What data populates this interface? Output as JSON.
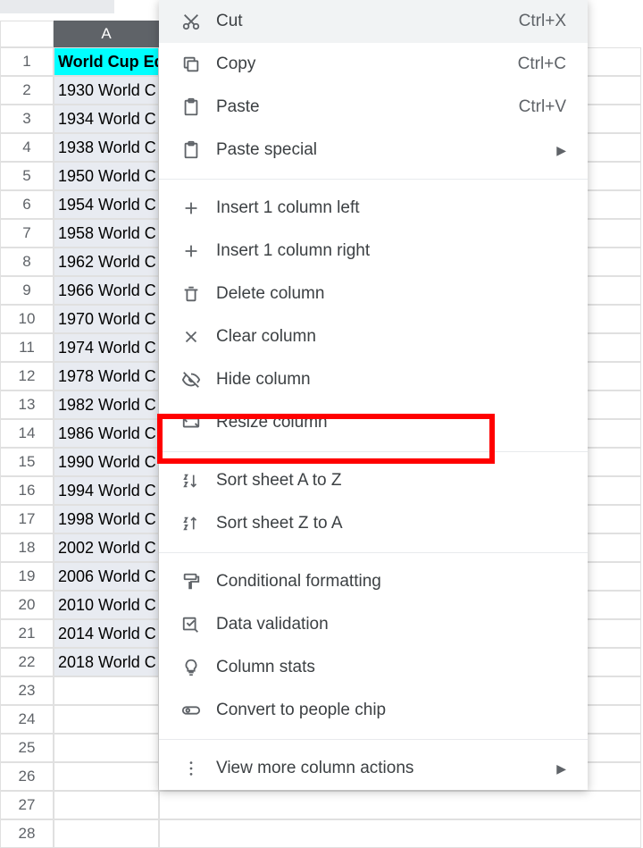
{
  "columnHeader": "A",
  "rows": [
    {
      "num": "1",
      "val": "World Cup Ed",
      "hdr": true
    },
    {
      "num": "2",
      "val": "1930 World C"
    },
    {
      "num": "3",
      "val": "1934 World C"
    },
    {
      "num": "4",
      "val": "1938 World C"
    },
    {
      "num": "5",
      "val": "1950 World C"
    },
    {
      "num": "6",
      "val": "1954 World C"
    },
    {
      "num": "7",
      "val": "1958 World C"
    },
    {
      "num": "8",
      "val": "1962 World C"
    },
    {
      "num": "9",
      "val": "1966 World C"
    },
    {
      "num": "10",
      "val": "1970 World C"
    },
    {
      "num": "11",
      "val": "1974 World C"
    },
    {
      "num": "12",
      "val": "1978 World C"
    },
    {
      "num": "13",
      "val": "1982 World C"
    },
    {
      "num": "14",
      "val": "1986 World C"
    },
    {
      "num": "15",
      "val": "1990 World C"
    },
    {
      "num": "16",
      "val": "1994 World C"
    },
    {
      "num": "17",
      "val": "1998 World C"
    },
    {
      "num": "18",
      "val": "2002 World C"
    },
    {
      "num": "19",
      "val": "2006 World C"
    },
    {
      "num": "20",
      "val": "2010 World C"
    },
    {
      "num": "21",
      "val": "2014 World C"
    },
    {
      "num": "22",
      "val": "2018 World C"
    },
    {
      "num": "23",
      "val": "",
      "empty": true
    },
    {
      "num": "24",
      "val": "",
      "empty": true
    },
    {
      "num": "25",
      "val": "",
      "empty": true
    },
    {
      "num": "26",
      "val": "",
      "empty": true
    },
    {
      "num": "27",
      "val": "",
      "empty": true
    },
    {
      "num": "28",
      "val": "",
      "empty": true
    }
  ],
  "menu": {
    "cut": "Cut",
    "cut_sc": "Ctrl+X",
    "copy": "Copy",
    "copy_sc": "Ctrl+C",
    "paste": "Paste",
    "paste_sc": "Ctrl+V",
    "paste_special": "Paste special",
    "insert_left": "Insert 1 column left",
    "insert_right": "Insert 1 column right",
    "delete": "Delete column",
    "clear": "Clear column",
    "hide": "Hide column",
    "resize": "Resize column",
    "sort_az": "Sort sheet A to Z",
    "sort_za": "Sort sheet Z to A",
    "cond_fmt": "Conditional formatting",
    "data_val": "Data validation",
    "col_stats": "Column stats",
    "people_chip": "Convert to people chip",
    "more": "View more column actions"
  }
}
